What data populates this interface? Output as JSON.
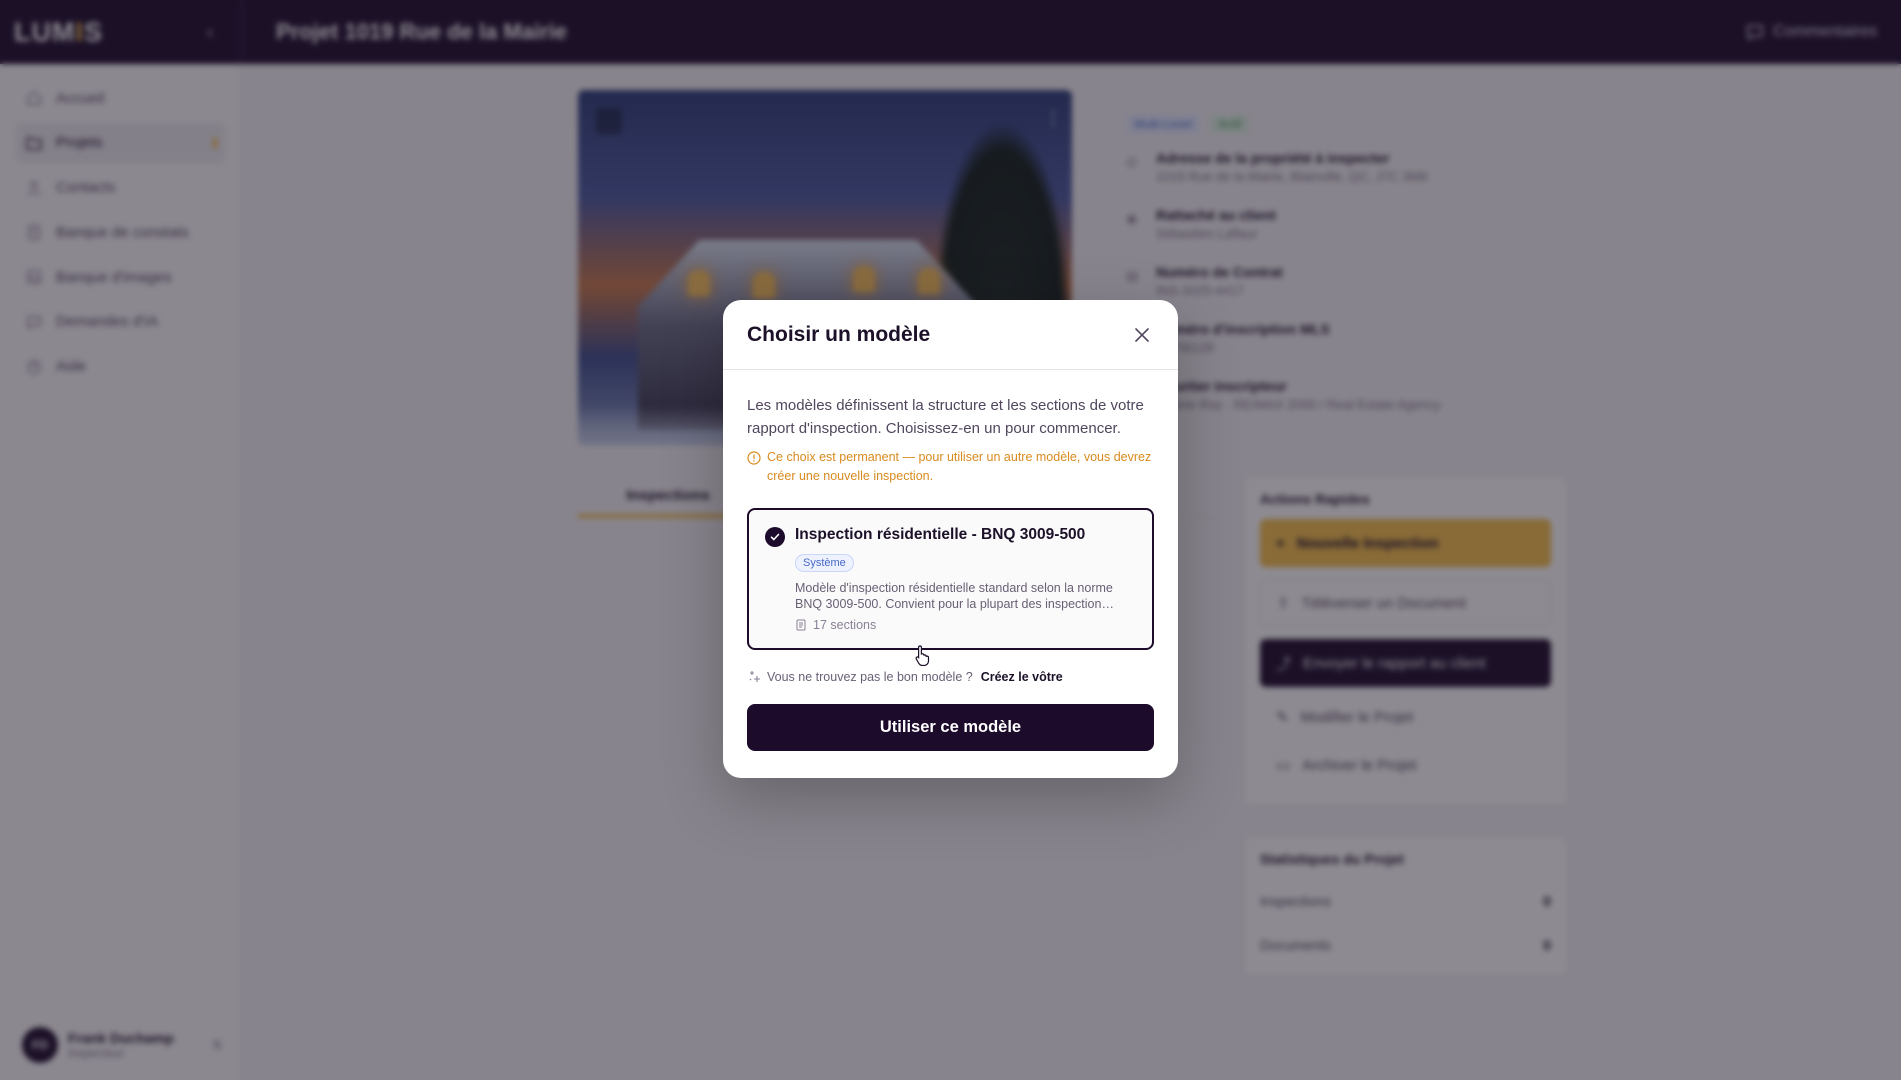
{
  "header": {
    "logo_text": "LUM",
    "logo_accent": "I",
    "logo_tail": "S",
    "project_title": "Projet 1019 Rue de la Mairie",
    "comment_label": "Commentaires"
  },
  "sidebar": {
    "items": [
      {
        "label": "Accueil",
        "icon": "home-icon"
      },
      {
        "label": "Projets",
        "icon": "folder-icon"
      },
      {
        "label": "Contacts",
        "icon": "user-icon"
      },
      {
        "label": "Banque de constats",
        "icon": "clipboard-icon"
      },
      {
        "label": "Banque d'images",
        "icon": "image-icon"
      },
      {
        "label": "Demandes d'IA",
        "icon": "chat-icon"
      },
      {
        "label": "Aide",
        "icon": "help-icon"
      }
    ],
    "user": {
      "initials": "FD",
      "name": "Frank Duchamp",
      "role": "Inspecteur"
    }
  },
  "main": {
    "tags": [
      "Multi-Level",
      "Actif"
    ],
    "info": [
      {
        "label": "Adresse de la propriété à inspecter",
        "value": "1019 Rue de la Mairie, Blainville, QC, J7C 3M6"
      },
      {
        "label": "Rattaché au client",
        "value": "Sébastien Laflaur"
      },
      {
        "label": "Numéro de Contrat",
        "value": "INS-2025-4417"
      },
      {
        "label": "Numéro d'inscription MLS",
        "value": "21756128"
      },
      {
        "label": "Courtier inscripteur",
        "value": "Valérie Roy · RE/MAX 2000 / Real Estate Agency"
      }
    ],
    "tab_active": "Inspections",
    "actions": {
      "title": "Actions Rapides",
      "new_inspection": "Nouvelle Inspection",
      "upload_doc": "Téléverser un Document",
      "send_report": "Envoyer le rapport au client",
      "edit_project": "Modifier le Projet",
      "archive_project": "Archiver le Projet"
    },
    "stats": {
      "title": "Statistiques du Projet",
      "inspections_label": "Inspections",
      "inspections_count": "0",
      "documents_label": "Documents",
      "documents_count": "0"
    }
  },
  "modal": {
    "title": "Choisir un modèle",
    "description": "Les modèles définissent la structure et les sections de votre rapport d'inspection. Choisissez-en un pour commencer.",
    "warning": "Ce choix est permanent — pour utiliser un autre modèle, vous devrez créer une nouvelle inspection.",
    "template": {
      "name": "Inspection résidentielle - BNQ 3009-500",
      "badge": "Système",
      "description": "Modèle d'inspection résidentielle standard selon la norme BNQ 3009-500. Convient pour la plupart des inspection…",
      "sections": "17 sections",
      "selected": true
    },
    "cta_text": "Vous ne trouvez pas le bon modèle ?",
    "cta_link": "Créez le vôtre",
    "primary_button": "Utiliser ce modèle"
  },
  "colors": {
    "brand_dark": "#1c0b2b",
    "accent_yellow": "#f4c04a",
    "warning_orange": "#d98a1e",
    "badge_blue": "#4669c8"
  }
}
